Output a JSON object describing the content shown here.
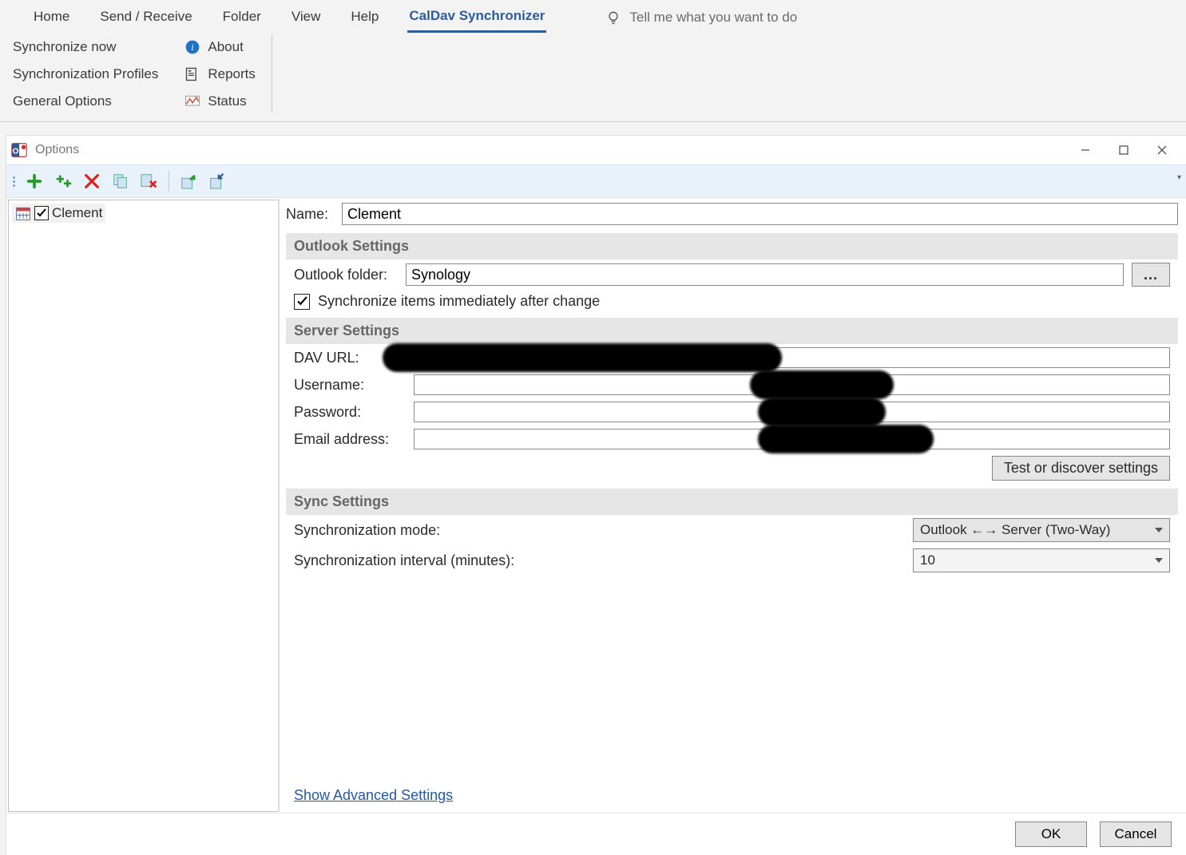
{
  "ribbon": {
    "tabs": [
      "Home",
      "Send / Receive",
      "Folder",
      "View",
      "Help",
      "CalDav Synchronizer"
    ],
    "active_tab": "CalDav Synchronizer",
    "tellme": "Tell me what you want to do",
    "group1": {
      "sync_now": "Synchronize now",
      "profiles": "Synchronization Profiles",
      "general": "General Options"
    },
    "group2": {
      "about": "About",
      "reports": "Reports",
      "status": "Status"
    }
  },
  "dialog": {
    "title": "Options",
    "toolbar_icons": [
      "add",
      "add-multi",
      "delete",
      "copy",
      "paste-del",
      "export",
      "import"
    ],
    "tree": {
      "items": [
        {
          "checked": true,
          "label": "Clement"
        }
      ]
    },
    "form": {
      "name_label": "Name:",
      "name_value": "Clement",
      "outlook_header": "Outlook Settings",
      "outlook_folder_label": "Outlook folder:",
      "outlook_folder_value": "Synology",
      "browse_btn": "...",
      "sync_immediate_checked": true,
      "sync_immediate_label": "Synchronize items immediately after change",
      "server_header": "Server Settings",
      "dav_url_label": "DAV URL:",
      "username_label": "Username:",
      "password_label": "Password:",
      "email_label": "Email address:",
      "test_btn": "Test or discover settings",
      "sync_header": "Sync Settings",
      "sync_mode_label": "Synchronization mode:",
      "sync_mode_value": "Outlook ←→ Server (Two-Way)",
      "sync_interval_label": "Synchronization interval (minutes):",
      "sync_interval_value": "10",
      "advanced_link": "Show Advanced Settings"
    },
    "footer": {
      "ok": "OK",
      "cancel": "Cancel"
    }
  }
}
